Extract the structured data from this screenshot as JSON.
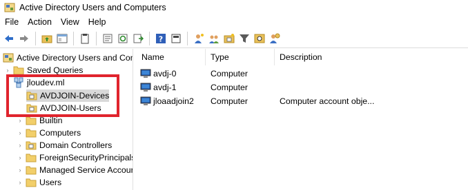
{
  "window": {
    "title": "Active Directory Users and Computers"
  },
  "menu": [
    "File",
    "Action",
    "View",
    "Help"
  ],
  "toolbar": {
    "buttons": [
      "back-icon",
      "forward-icon",
      "up-folder-icon",
      "show-hide-tree-icon",
      "clipboard-icon",
      "properties-icon",
      "refresh-icon",
      "export-list-icon",
      "help-icon",
      "snapin-icon",
      "new-user-icon",
      "new-group-icon",
      "new-ou-icon",
      "filter-icon",
      "find-icon",
      "add-to-group-icon"
    ]
  },
  "tree": {
    "root": "Active Directory Users and Com",
    "saved_queries": "Saved Queries",
    "domain": "jloudev.ml",
    "items": [
      "AVDJOIN-Devices",
      "AVDJOIN-Users",
      "Builtin",
      "Computers",
      "Domain Controllers",
      "ForeignSecurityPrincipals",
      "Managed Service Accour",
      "Users"
    ],
    "selected": "AVDJOIN-Devices"
  },
  "list": {
    "columns": [
      "Name",
      "Type",
      "Description"
    ],
    "rows": [
      {
        "name": "avdj-0",
        "type": "Computer",
        "description": ""
      },
      {
        "name": "avdj-1",
        "type": "Computer",
        "description": ""
      },
      {
        "name": "jloaadjoin2",
        "type": "Computer",
        "description": "Computer account obje..."
      }
    ]
  },
  "colors": {
    "highlight_box": "#e0242d",
    "selected_row": "#d9d9d9"
  }
}
